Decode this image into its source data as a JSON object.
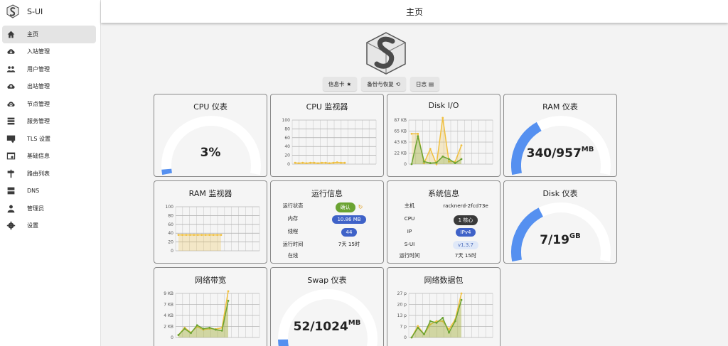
{
  "app": {
    "name": "S-UI"
  },
  "header": {
    "title": "主页"
  },
  "sidebar": {
    "items": [
      {
        "label": "主页",
        "icon": "home-icon",
        "active": true
      },
      {
        "label": "入站管理",
        "icon": "cloud-download-icon"
      },
      {
        "label": "用户管理",
        "icon": "users-icon"
      },
      {
        "label": "出站管理",
        "icon": "cloud-upload-icon"
      },
      {
        "label": "节点管理",
        "icon": "cloud-sync-icon"
      },
      {
        "label": "服务管理",
        "icon": "server-icon"
      },
      {
        "label": "TLS 设置",
        "icon": "certificate-icon"
      },
      {
        "label": "基础信息",
        "icon": "settings-box-icon"
      },
      {
        "label": "路由列表",
        "icon": "signpost-icon"
      },
      {
        "label": "DNS",
        "icon": "dns-icon"
      },
      {
        "label": "管理员",
        "icon": "admin-icon"
      },
      {
        "label": "设置",
        "icon": "gear-icon"
      }
    ]
  },
  "actions": {
    "cards": "信息卡",
    "backup": "备份与恢复",
    "logs": "日志"
  },
  "colors": {
    "accent": "#5590f0",
    "track": "#ffffff",
    "line_yellow": "#f0c040",
    "line_green": "#6aa332"
  },
  "cards": {
    "cpu_gauge": {
      "title": "CPU 仪表",
      "value": "3%",
      "percent": 3
    },
    "cpu_monitor": {
      "title": "CPU 监视器"
    },
    "disk_io": {
      "title": "Disk I/O"
    },
    "ram_gauge": {
      "title": "RAM 仪表",
      "value": "340/957",
      "unit": "MB",
      "percent": 35.5
    },
    "ram_monitor": {
      "title": "RAM 监视器"
    },
    "run_info": {
      "title": "运行信息",
      "rows": [
        {
          "key": "运行状态",
          "value": "确认"
        },
        {
          "key": "内存",
          "value": "10.86 MB"
        },
        {
          "key": "线程",
          "value": "44"
        },
        {
          "key": "运行时间",
          "value": "7天 15时"
        },
        {
          "key": "在线",
          "value": ""
        }
      ]
    },
    "sys_info": {
      "title": "系统信息",
      "rows": [
        {
          "key": "主机",
          "value": "racknerd-2fcd73e"
        },
        {
          "key": "CPU",
          "value": "1 核心"
        },
        {
          "key": "IP",
          "value": "IPv4"
        },
        {
          "key": "S-UI",
          "value": "v1.3.7"
        },
        {
          "key": "运行时间",
          "value": "7天 15时"
        }
      ]
    },
    "disk_gauge": {
      "title": "Disk 仪表",
      "value": "7/19",
      "unit": "GB",
      "percent": 36.8
    },
    "net_bw": {
      "title": "网络带宽"
    },
    "swap_gauge": {
      "title": "Swap 仪表",
      "value": "52/1024",
      "unit": "MB",
      "percent": 5
    },
    "net_pkt": {
      "title": "网络数据包"
    }
  },
  "chart_data": [
    {
      "type": "line",
      "title": "CPU 监视器",
      "yticks": [
        "100",
        "80",
        "60",
        "40",
        "20",
        "0"
      ],
      "ylim": [
        0,
        100
      ],
      "series": [
        {
          "color": "#f0c040",
          "values": [
            3,
            2,
            3,
            2,
            3,
            3,
            2,
            3,
            3,
            2,
            3,
            4,
            3,
            3
          ]
        }
      ]
    },
    {
      "type": "line",
      "title": "Disk I/O",
      "yticks": [
        "87 KB",
        "65 KB",
        "43 KB",
        "22 KB",
        "0"
      ],
      "ylim": [
        0,
        87
      ],
      "series": [
        {
          "color": "#f0c040",
          "values": [
            60,
            60,
            2,
            30,
            0,
            94,
            5,
            5,
            37
          ]
        },
        {
          "color": "#6aa332",
          "values": [
            0,
            55,
            5,
            2,
            3,
            15,
            10,
            2,
            10
          ]
        }
      ]
    },
    {
      "type": "area",
      "title": "RAM 监视器",
      "yticks": [
        "100",
        "80",
        "60",
        "40",
        "20",
        "0"
      ],
      "ylim": [
        0,
        100
      ],
      "series": [
        {
          "color": "#f0c040",
          "values": [
            36,
            36,
            36,
            36,
            36,
            36,
            36,
            36,
            36,
            36,
            36,
            36
          ]
        }
      ]
    },
    {
      "type": "line",
      "title": "网络带宽",
      "yticks": [
        "9 KB",
        "7 KB",
        "4 KB",
        "2 KB",
        "0"
      ],
      "ylim": [
        0,
        9
      ],
      "series": [
        {
          "color": "#f0c040",
          "values": [
            0.5,
            2,
            1,
            2.2,
            1.6,
            1.8,
            1.7,
            2,
            9.5
          ]
        },
        {
          "color": "#6aa332",
          "values": [
            0.5,
            1.8,
            0.9,
            2.5,
            1.8,
            2,
            1.6,
            1.4,
            7.5
          ]
        }
      ]
    },
    {
      "type": "line",
      "title": "网络数据包",
      "yticks": [
        "27 p",
        "20 p",
        "13 p",
        "7 p",
        "0"
      ],
      "ylim": [
        0,
        27
      ],
      "series": [
        {
          "color": "#f0c040",
          "values": [
            0,
            7,
            2,
            8,
            10,
            10,
            5,
            11,
            27
          ]
        },
        {
          "color": "#6aa332",
          "values": [
            0,
            6,
            2,
            10,
            9,
            12,
            3,
            10,
            23
          ]
        }
      ]
    }
  ]
}
